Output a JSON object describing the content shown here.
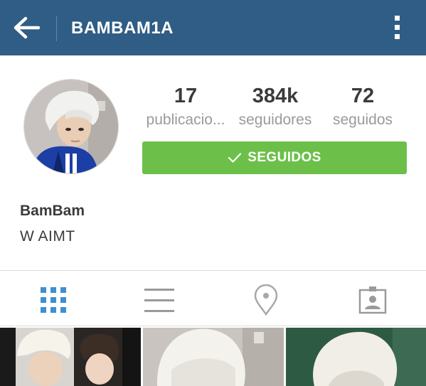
{
  "header": {
    "username": "BAMBAM1A",
    "back_icon": "arrow-left-icon",
    "menu_icon": "more-vertical-icon",
    "background_color": "#2f5d85"
  },
  "profile": {
    "avatar": "profile-photo",
    "stats": [
      {
        "value": "17",
        "label": "publicacio..."
      },
      {
        "value": "384k",
        "label": "seguidores"
      },
      {
        "value": "72",
        "label": "seguidos"
      }
    ],
    "follow_button": {
      "label": "SEGUIDOS",
      "icon": "check-icon",
      "color": "#6cc04a"
    },
    "full_name": "BamBam",
    "bio": "W AIMT"
  },
  "tabs": [
    {
      "icon": "grid-icon",
      "active": true,
      "active_color": "#3f8fd2"
    },
    {
      "icon": "list-icon",
      "active": false
    },
    {
      "icon": "location-pin-icon",
      "active": false
    },
    {
      "icon": "tagged-photos-icon",
      "active": false
    }
  ],
  "grid_photos": [
    "photo-1",
    "photo-2",
    "photo-3"
  ]
}
